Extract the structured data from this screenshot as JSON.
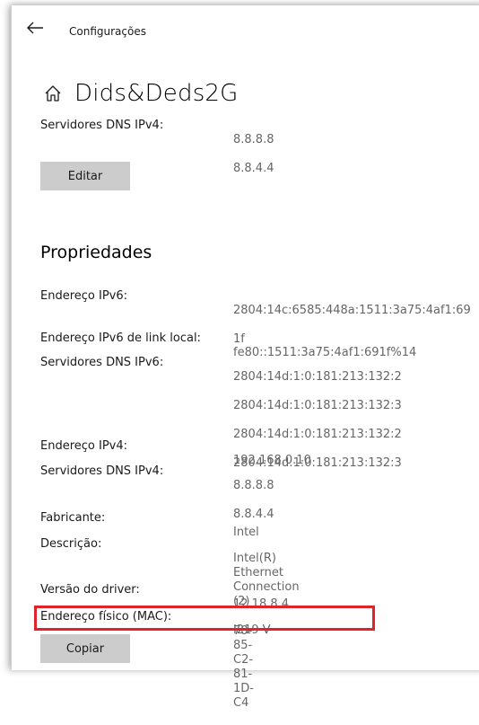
{
  "titlebar": {
    "title": "Configurações"
  },
  "header": {
    "network_name": "Dids&Deds2G"
  },
  "top_dns": {
    "label": "Servidores DNS IPv4:",
    "values": [
      "8.8.8.8",
      "8.8.4.4"
    ]
  },
  "edit_button": {
    "label": "Editar"
  },
  "properties": {
    "title": "Propriedades",
    "rows": [
      {
        "label": "Endereço IPv6:",
        "values": [
          "2804:14c:6585:448a:1511:3a75:4af1:69",
          "1f"
        ]
      },
      {
        "label": "Endereço IPv6 de link local:",
        "values": [
          "fe80::1511:3a75:4af1:691f%14"
        ]
      },
      {
        "label": "Servidores DNS IPv6:",
        "values": [
          "2804:14d:1:0:181:213:132:2",
          "2804:14d:1:0:181:213:132:3",
          "2804:14d:1:0:181:213:132:2",
          "2804:14d:1:0:181:213:132:3"
        ]
      },
      {
        "label": "Endereço IPv4:",
        "values": [
          "192.168.0.10"
        ]
      },
      {
        "label": "Servidores DNS IPv4:",
        "values": [
          "8.8.8.8",
          "8.8.4.4"
        ]
      },
      {
        "label": "Fabricante:",
        "values": [
          "Intel"
        ]
      },
      {
        "label": "Descrição:",
        "values": [
          "Intel(R) Ethernet Connection (2)",
          "I219-V"
        ]
      },
      {
        "label": "Versão do driver:",
        "values": [
          "12.18.8.4"
        ]
      },
      {
        "label": "Endereço físico (MAC):",
        "values": [
          "70-85-C2-81-1D-C4"
        ]
      }
    ]
  },
  "copy_button": {
    "label": "Copiar"
  },
  "colors": {
    "highlight": "#e0242c",
    "value_text": "#666666",
    "button_bg": "#cccccc"
  },
  "icons": {
    "back": "back-arrow-icon",
    "home": "home-icon"
  }
}
